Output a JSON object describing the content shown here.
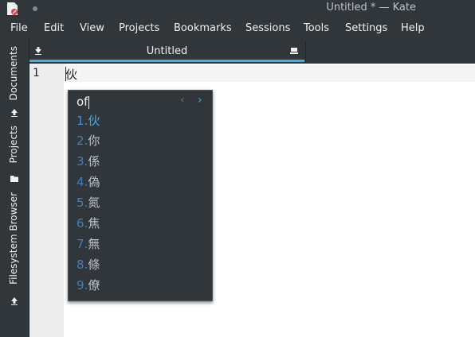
{
  "window": {
    "title": "Untitled * — Kate"
  },
  "menu": [
    "File",
    "Edit",
    "View",
    "Projects",
    "Bookmarks",
    "Sessions",
    "Tools",
    "Settings",
    "Help"
  ],
  "sidebar": {
    "tabs": [
      "Documents",
      "Projects",
      "Filesystem Browser"
    ]
  },
  "tabs": [
    {
      "label": "Untitled"
    }
  ],
  "editor": {
    "line_number": "1",
    "text": "伙"
  },
  "ime": {
    "preedit": "of",
    "candidates": [
      {
        "index": "1.",
        "char": "伙",
        "selected": true
      },
      {
        "index": "2.",
        "char": "你"
      },
      {
        "index": "3.",
        "char": "係"
      },
      {
        "index": "4.",
        "char": "偽"
      },
      {
        "index": "5.",
        "char": "氮"
      },
      {
        "index": "6.",
        "char": "焦"
      },
      {
        "index": "7.",
        "char": "無"
      },
      {
        "index": "8.",
        "char": "條"
      },
      {
        "index": "9.",
        "char": "僚"
      }
    ]
  },
  "colors": {
    "accent": "#3daee9",
    "window_bg": "#31363b",
    "editor_bg": "#ffffff",
    "gutter_bg": "#ececec"
  }
}
